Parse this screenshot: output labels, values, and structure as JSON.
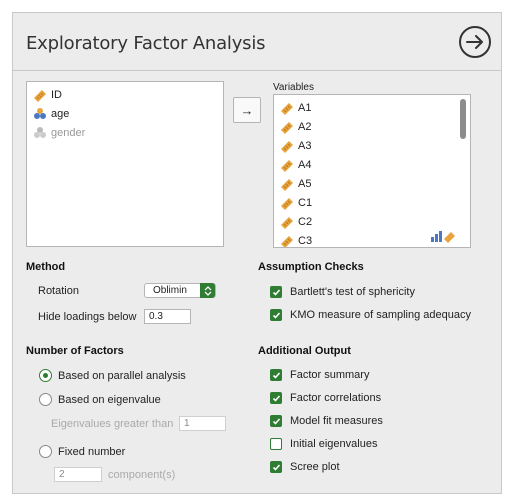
{
  "header": {
    "title": "Exploratory Factor Analysis"
  },
  "available_vars": [
    {
      "name": "ID",
      "type": "continuous"
    },
    {
      "name": "age",
      "type": "nominal"
    },
    {
      "name": "gender",
      "type": "nominal"
    }
  ],
  "variables": {
    "label": "Variables",
    "items": [
      "A1",
      "A2",
      "A3",
      "A4",
      "A5",
      "C1",
      "C2",
      "C3"
    ]
  },
  "method": {
    "title": "Method",
    "rotation_label": "Rotation",
    "rotation_value": "Oblimin",
    "hide_label": "Hide loadings below",
    "hide_value": "0.3"
  },
  "assumption": {
    "title": "Assumption Checks",
    "items": [
      {
        "label": "Bartlett's test of sphericity",
        "checked": true
      },
      {
        "label": "KMO measure of sampling adequacy",
        "checked": true
      }
    ]
  },
  "factors": {
    "title": "Number of Factors",
    "parallel": "Based on parallel analysis",
    "eigen": "Based on eigenvalue",
    "eigen_gt_label": "Eigenvalues greater than",
    "eigen_gt_value": "1",
    "fixed": "Fixed number",
    "fixed_value": "2",
    "fixed_unit": "component(s)",
    "selected": "parallel"
  },
  "additional": {
    "title": "Additional Output",
    "items": [
      {
        "label": "Factor summary",
        "checked": true
      },
      {
        "label": "Factor correlations",
        "checked": true
      },
      {
        "label": "Model fit measures",
        "checked": true
      },
      {
        "label": "Initial eigenvalues",
        "checked": false
      },
      {
        "label": "Scree plot",
        "checked": true
      }
    ]
  },
  "colors": {
    "accent": "#2e7d32",
    "continuous": "#e8a33d",
    "nominal": "#4a78c2"
  }
}
